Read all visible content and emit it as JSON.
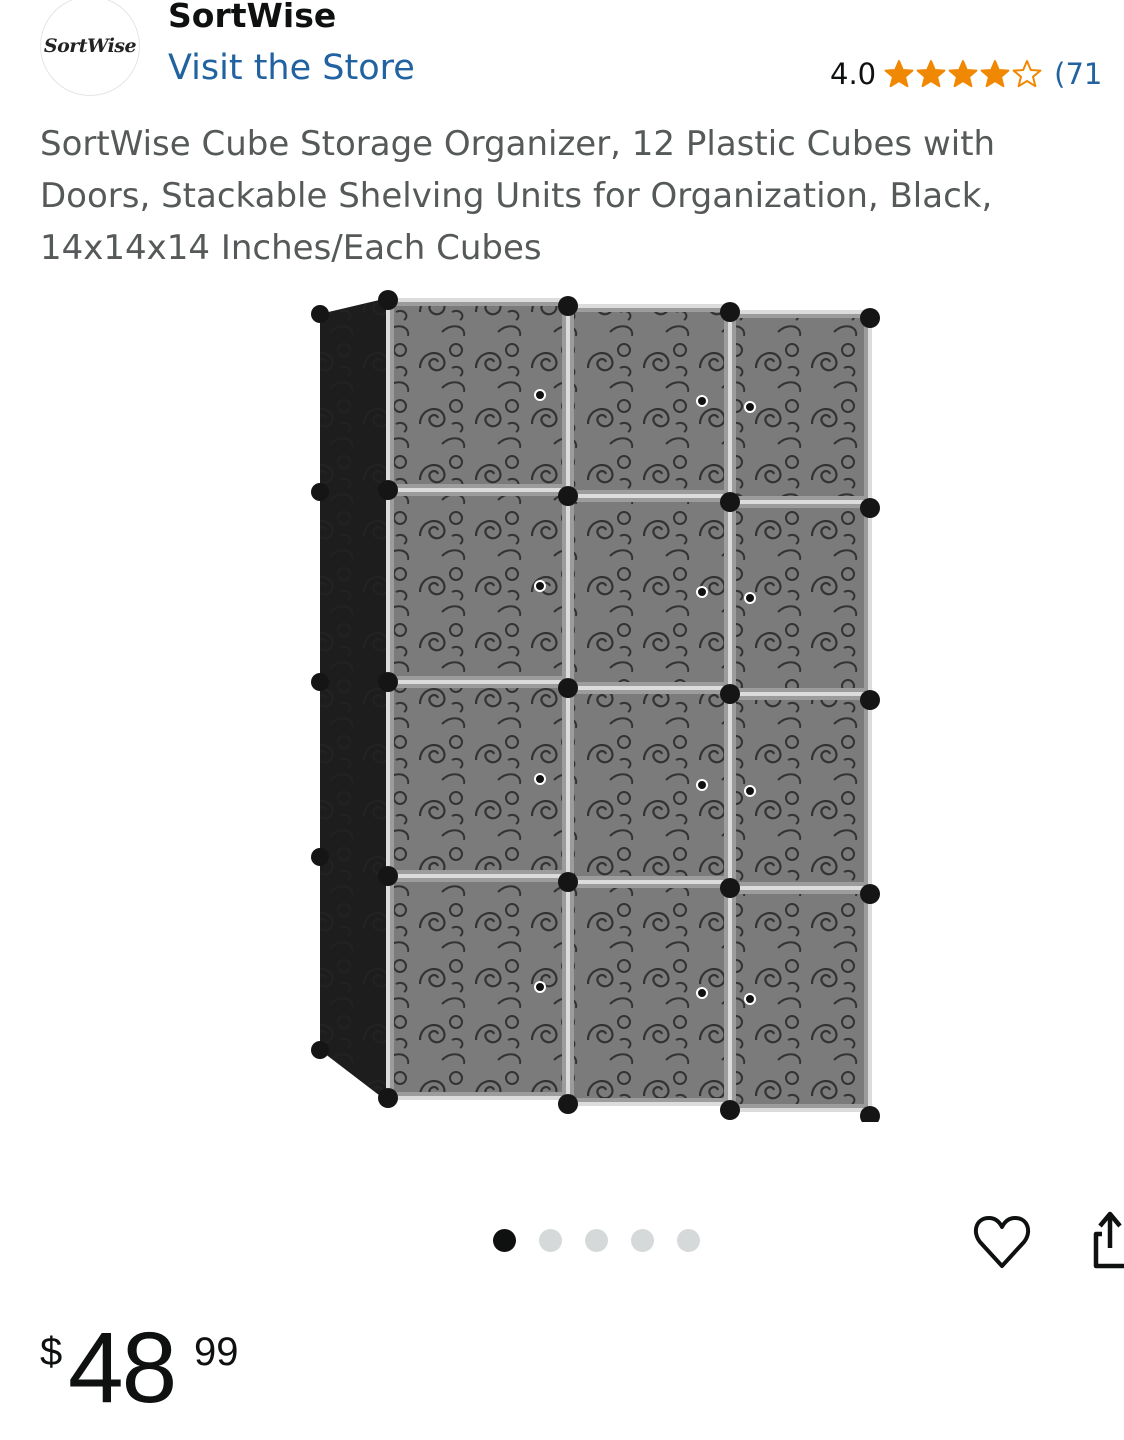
{
  "store": {
    "logo_text": "SortWise",
    "brand_name": "SortWise",
    "visit_store_label": "Visit the Store"
  },
  "rating": {
    "value": "4.0",
    "stars_filled": 4,
    "stars_total": 5,
    "review_count": "(71"
  },
  "product": {
    "title": "SortWise Cube Storage Organizer, 12 Plastic Cubes with Doors, Stackable Shelving Units for Organization, Black, 14x14x14 Inches/Each Cubes",
    "image_icon": "cube-storage-organizer-photo"
  },
  "carousel": {
    "total": 5,
    "active_index": 0
  },
  "actions": {
    "favorite_icon": "heart-icon",
    "share_icon": "share-icon"
  },
  "price": {
    "symbol": "$",
    "whole": "48",
    "fraction": "99"
  },
  "colors": {
    "link": "#2162a1",
    "star": "#f08804",
    "text": "#0f1111",
    "muted": "#565959"
  }
}
